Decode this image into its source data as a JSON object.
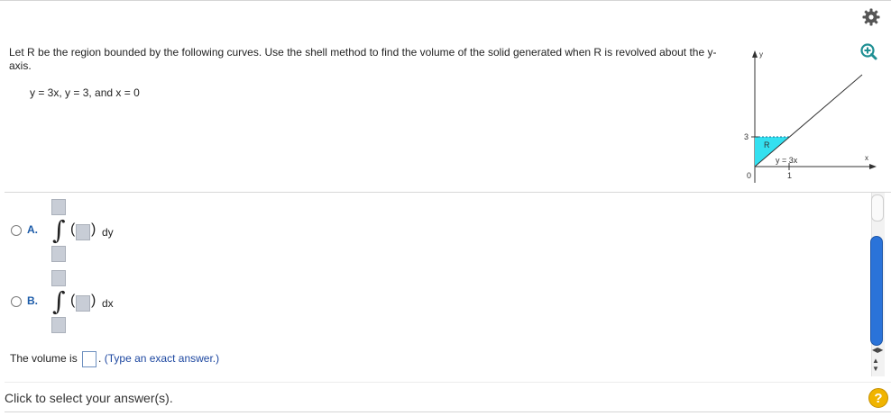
{
  "question": {
    "text": "Let R be the region bounded by the following curves. Use the shell method to find the volume of the solid generated when R is revolved about the y-axis.",
    "equation": "y = 3x, y = 3, and x = 0"
  },
  "graph": {
    "y_axis_label": "y",
    "x_axis_label": "x",
    "region_label": "R",
    "curve_label": "y = 3x",
    "y_tick": "3",
    "x_tick": "1",
    "origin_label": "0",
    "region_color": "#33e0f0"
  },
  "options": [
    {
      "label": "A.",
      "differential": "dy"
    },
    {
      "label": "B.",
      "differential": "dx"
    }
  ],
  "answer": {
    "prefix": "The volume is",
    "suffix": ".",
    "hint": "(Type an exact answer.)"
  },
  "status": "Click to select your answer(s).",
  "help_label": "?",
  "icons": {
    "settings": "gear-icon",
    "zoom": "zoom-in-icon",
    "help": "help-icon"
  }
}
